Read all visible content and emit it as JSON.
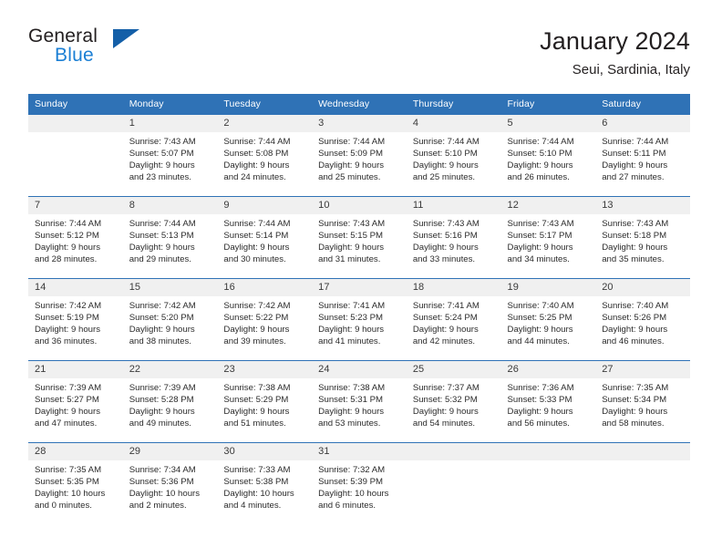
{
  "logo": {
    "word_one": "General",
    "word_two": "Blue",
    "triangle": "blue-triangle-icon"
  },
  "header": {
    "title": "January 2024",
    "location": "Seui, Sardinia, Italy"
  },
  "colors": {
    "header_blue": "#2f72b6",
    "logo_blue": "#1b7fd4",
    "triangle_blue": "#145fa8",
    "daynum_band": "#f0f0f0",
    "text": "#2b2b2b"
  },
  "weekdays": [
    "Sunday",
    "Monday",
    "Tuesday",
    "Wednesday",
    "Thursday",
    "Friday",
    "Saturday"
  ],
  "weeks": [
    [
      {
        "day": "",
        "sunrise": "",
        "sunset": "",
        "daylight1": "",
        "daylight2": ""
      },
      {
        "day": "1",
        "sunrise": "Sunrise: 7:43 AM",
        "sunset": "Sunset: 5:07 PM",
        "daylight1": "Daylight: 9 hours",
        "daylight2": "and 23 minutes."
      },
      {
        "day": "2",
        "sunrise": "Sunrise: 7:44 AM",
        "sunset": "Sunset: 5:08 PM",
        "daylight1": "Daylight: 9 hours",
        "daylight2": "and 24 minutes."
      },
      {
        "day": "3",
        "sunrise": "Sunrise: 7:44 AM",
        "sunset": "Sunset: 5:09 PM",
        "daylight1": "Daylight: 9 hours",
        "daylight2": "and 25 minutes."
      },
      {
        "day": "4",
        "sunrise": "Sunrise: 7:44 AM",
        "sunset": "Sunset: 5:10 PM",
        "daylight1": "Daylight: 9 hours",
        "daylight2": "and 25 minutes."
      },
      {
        "day": "5",
        "sunrise": "Sunrise: 7:44 AM",
        "sunset": "Sunset: 5:10 PM",
        "daylight1": "Daylight: 9 hours",
        "daylight2": "and 26 minutes."
      },
      {
        "day": "6",
        "sunrise": "Sunrise: 7:44 AM",
        "sunset": "Sunset: 5:11 PM",
        "daylight1": "Daylight: 9 hours",
        "daylight2": "and 27 minutes."
      }
    ],
    [
      {
        "day": "7",
        "sunrise": "Sunrise: 7:44 AM",
        "sunset": "Sunset: 5:12 PM",
        "daylight1": "Daylight: 9 hours",
        "daylight2": "and 28 minutes."
      },
      {
        "day": "8",
        "sunrise": "Sunrise: 7:44 AM",
        "sunset": "Sunset: 5:13 PM",
        "daylight1": "Daylight: 9 hours",
        "daylight2": "and 29 minutes."
      },
      {
        "day": "9",
        "sunrise": "Sunrise: 7:44 AM",
        "sunset": "Sunset: 5:14 PM",
        "daylight1": "Daylight: 9 hours",
        "daylight2": "and 30 minutes."
      },
      {
        "day": "10",
        "sunrise": "Sunrise: 7:43 AM",
        "sunset": "Sunset: 5:15 PM",
        "daylight1": "Daylight: 9 hours",
        "daylight2": "and 31 minutes."
      },
      {
        "day": "11",
        "sunrise": "Sunrise: 7:43 AM",
        "sunset": "Sunset: 5:16 PM",
        "daylight1": "Daylight: 9 hours",
        "daylight2": "and 33 minutes."
      },
      {
        "day": "12",
        "sunrise": "Sunrise: 7:43 AM",
        "sunset": "Sunset: 5:17 PM",
        "daylight1": "Daylight: 9 hours",
        "daylight2": "and 34 minutes."
      },
      {
        "day": "13",
        "sunrise": "Sunrise: 7:43 AM",
        "sunset": "Sunset: 5:18 PM",
        "daylight1": "Daylight: 9 hours",
        "daylight2": "and 35 minutes."
      }
    ],
    [
      {
        "day": "14",
        "sunrise": "Sunrise: 7:42 AM",
        "sunset": "Sunset: 5:19 PM",
        "daylight1": "Daylight: 9 hours",
        "daylight2": "and 36 minutes."
      },
      {
        "day": "15",
        "sunrise": "Sunrise: 7:42 AM",
        "sunset": "Sunset: 5:20 PM",
        "daylight1": "Daylight: 9 hours",
        "daylight2": "and 38 minutes."
      },
      {
        "day": "16",
        "sunrise": "Sunrise: 7:42 AM",
        "sunset": "Sunset: 5:22 PM",
        "daylight1": "Daylight: 9 hours",
        "daylight2": "and 39 minutes."
      },
      {
        "day": "17",
        "sunrise": "Sunrise: 7:41 AM",
        "sunset": "Sunset: 5:23 PM",
        "daylight1": "Daylight: 9 hours",
        "daylight2": "and 41 minutes."
      },
      {
        "day": "18",
        "sunrise": "Sunrise: 7:41 AM",
        "sunset": "Sunset: 5:24 PM",
        "daylight1": "Daylight: 9 hours",
        "daylight2": "and 42 minutes."
      },
      {
        "day": "19",
        "sunrise": "Sunrise: 7:40 AM",
        "sunset": "Sunset: 5:25 PM",
        "daylight1": "Daylight: 9 hours",
        "daylight2": "and 44 minutes."
      },
      {
        "day": "20",
        "sunrise": "Sunrise: 7:40 AM",
        "sunset": "Sunset: 5:26 PM",
        "daylight1": "Daylight: 9 hours",
        "daylight2": "and 46 minutes."
      }
    ],
    [
      {
        "day": "21",
        "sunrise": "Sunrise: 7:39 AM",
        "sunset": "Sunset: 5:27 PM",
        "daylight1": "Daylight: 9 hours",
        "daylight2": "and 47 minutes."
      },
      {
        "day": "22",
        "sunrise": "Sunrise: 7:39 AM",
        "sunset": "Sunset: 5:28 PM",
        "daylight1": "Daylight: 9 hours",
        "daylight2": "and 49 minutes."
      },
      {
        "day": "23",
        "sunrise": "Sunrise: 7:38 AM",
        "sunset": "Sunset: 5:29 PM",
        "daylight1": "Daylight: 9 hours",
        "daylight2": "and 51 minutes."
      },
      {
        "day": "24",
        "sunrise": "Sunrise: 7:38 AM",
        "sunset": "Sunset: 5:31 PM",
        "daylight1": "Daylight: 9 hours",
        "daylight2": "and 53 minutes."
      },
      {
        "day": "25",
        "sunrise": "Sunrise: 7:37 AM",
        "sunset": "Sunset: 5:32 PM",
        "daylight1": "Daylight: 9 hours",
        "daylight2": "and 54 minutes."
      },
      {
        "day": "26",
        "sunrise": "Sunrise: 7:36 AM",
        "sunset": "Sunset: 5:33 PM",
        "daylight1": "Daylight: 9 hours",
        "daylight2": "and 56 minutes."
      },
      {
        "day": "27",
        "sunrise": "Sunrise: 7:35 AM",
        "sunset": "Sunset: 5:34 PM",
        "daylight1": "Daylight: 9 hours",
        "daylight2": "and 58 minutes."
      }
    ],
    [
      {
        "day": "28",
        "sunrise": "Sunrise: 7:35 AM",
        "sunset": "Sunset: 5:35 PM",
        "daylight1": "Daylight: 10 hours",
        "daylight2": "and 0 minutes."
      },
      {
        "day": "29",
        "sunrise": "Sunrise: 7:34 AM",
        "sunset": "Sunset: 5:36 PM",
        "daylight1": "Daylight: 10 hours",
        "daylight2": "and 2 minutes."
      },
      {
        "day": "30",
        "sunrise": "Sunrise: 7:33 AM",
        "sunset": "Sunset: 5:38 PM",
        "daylight1": "Daylight: 10 hours",
        "daylight2": "and 4 minutes."
      },
      {
        "day": "31",
        "sunrise": "Sunrise: 7:32 AM",
        "sunset": "Sunset: 5:39 PM",
        "daylight1": "Daylight: 10 hours",
        "daylight2": "and 6 minutes."
      },
      {
        "day": "",
        "sunrise": "",
        "sunset": "",
        "daylight1": "",
        "daylight2": ""
      },
      {
        "day": "",
        "sunrise": "",
        "sunset": "",
        "daylight1": "",
        "daylight2": ""
      },
      {
        "day": "",
        "sunrise": "",
        "sunset": "",
        "daylight1": "",
        "daylight2": ""
      }
    ]
  ]
}
